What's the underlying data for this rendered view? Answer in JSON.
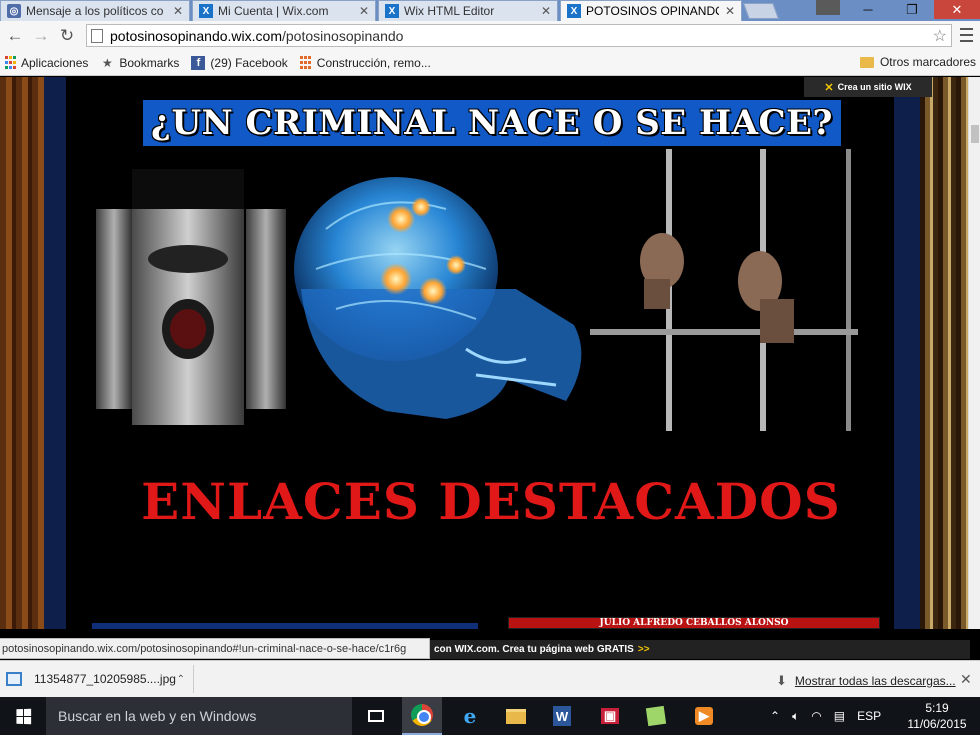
{
  "browser": {
    "tabs": [
      {
        "label": "Mensaje a los políticos co",
        "icon": "facebook-message-icon"
      },
      {
        "label": "Mi Cuenta | Wix.com",
        "icon": "wix-icon"
      },
      {
        "label": "Wix HTML Editor",
        "icon": "wix-icon"
      },
      {
        "label": "POTOSINOS OPINANDO",
        "icon": "wix-icon"
      }
    ],
    "window_controls": {
      "minimize": "─",
      "restore": "❐",
      "close": "✕"
    },
    "url": {
      "host": "potosinosopinando.wix.com",
      "path": "/potosinosopinando"
    },
    "bookmarks": [
      {
        "label": "Aplicaciones",
        "icon": "apps-icon"
      },
      {
        "label": "Bookmarks",
        "icon": "star-icon"
      },
      {
        "label": "(29) Facebook",
        "icon": "facebook-icon"
      },
      {
        "label": "Construcción, remo...",
        "icon": "apps-icon"
      }
    ],
    "other_bookmarks": "Otros marcadores"
  },
  "site": {
    "wix_badge": "Crea un sitio WIX",
    "title": "¿UN CRIMINAL NACE O SE HACE?",
    "headline": "ENLACES DESTACADOS",
    "card_right_name": "JULIO ALFREDO CEBALLOS ALONSO",
    "colors": {
      "banner": "#1159c7",
      "headline": "#e01818",
      "frame": "#0d1f4a"
    }
  },
  "status": {
    "hover_url": "potosinosopinando.wix.com/potosinosopinando#!un-criminal-nace-o-se-hace/c1r6g",
    "promo_prefix": "con ",
    "promo_brand": "WIX.com",
    "promo_rest": ". Crea tu página web GRATIS",
    "promo_arrows": ">>"
  },
  "downloads": {
    "file": "11354877_10205985....jpg",
    "show_all": "Mostrar todas las descargas..."
  },
  "taskbar": {
    "search_placeholder": "Buscar en la web y en Windows",
    "language": "ESP",
    "time": "5:19",
    "date": "11/06/2015",
    "apps": [
      "task-view",
      "chrome",
      "internet-explorer",
      "file-explorer",
      "word",
      "media",
      "sticky-notes",
      "media-player"
    ]
  }
}
